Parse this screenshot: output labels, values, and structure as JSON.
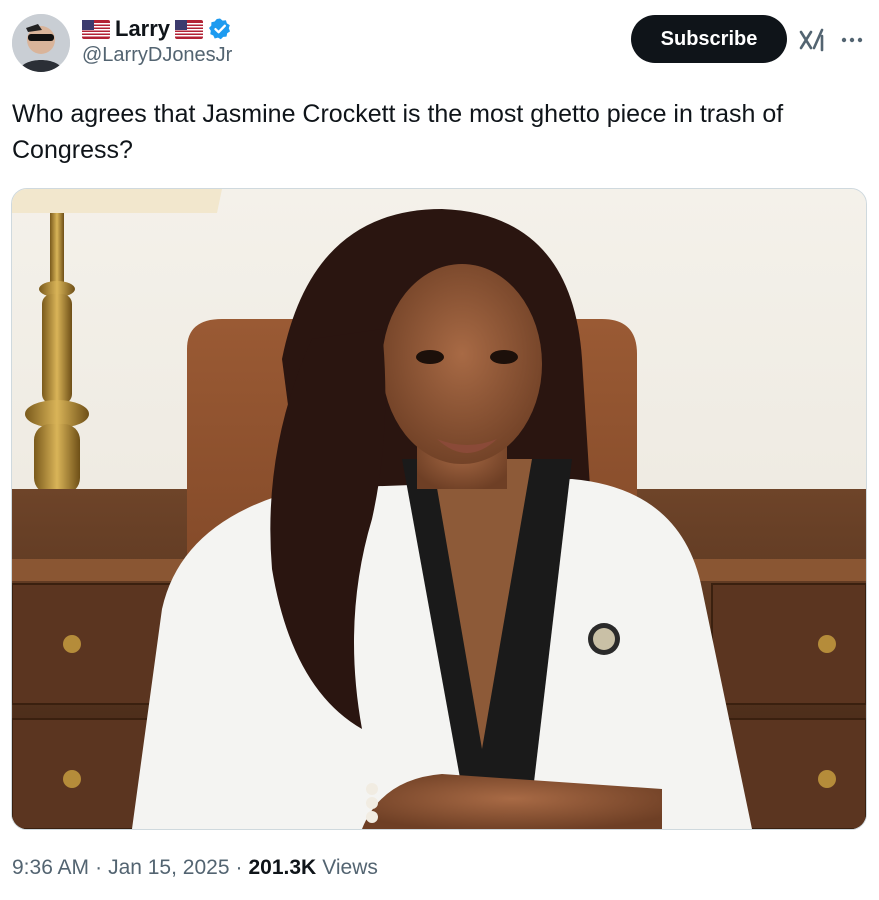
{
  "author": {
    "name": "Larry",
    "handle": "@LarryDJonesJr",
    "verified": true,
    "flag_icon": "us-flag-icon",
    "avatar_icon": "avatar"
  },
  "actions": {
    "subscribe_label": "Subscribe",
    "grok_icon": "grok-icon",
    "more_icon": "more-icon"
  },
  "tweet": {
    "text": "Who agrees that Jasmine Crockett is the most ghetto piece in trash of Congress?"
  },
  "media": {
    "kind": "photo"
  },
  "meta": {
    "time": "9:36 AM",
    "sep1": "·",
    "date": "Jan 15, 2025",
    "sep2": "·",
    "views_count": "201.3K",
    "views_label": "Views"
  },
  "colors": {
    "text": "#0f1419",
    "secondary": "#536471",
    "verified": "#1d9bf0",
    "border": "#cfd9de"
  }
}
